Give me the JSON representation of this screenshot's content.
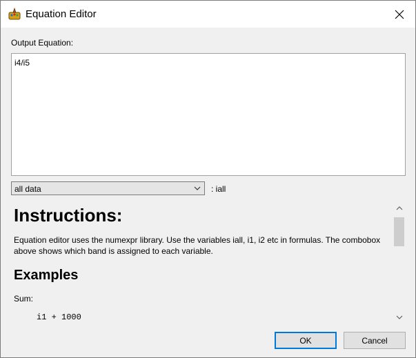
{
  "window": {
    "title": "Equation Editor",
    "icon": "paint-palette-icon"
  },
  "output": {
    "label": "Output Equation:",
    "value": "i4/i5"
  },
  "band_select": {
    "selected": "all data",
    "variable_label": ": iall"
  },
  "instructions": {
    "heading": "Instructions:",
    "body": "Equation editor uses the numexpr library. Use the variables iall, i1, i2 etc in formulas. The combobox above shows which band is assigned to each variable.",
    "examples_heading": "Examples",
    "example_label": "Sum:",
    "example_code": "i1 + 1000"
  },
  "buttons": {
    "ok": "OK",
    "cancel": "Cancel"
  },
  "colors": {
    "accent": "#0078d7",
    "window_bg": "#f0f0f0",
    "titlebar_bg": "#ffffff"
  }
}
